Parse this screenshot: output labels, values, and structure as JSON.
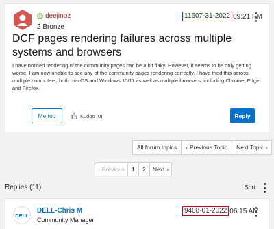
{
  "post": {
    "author": "deejinoz",
    "rank": "2 Bronze",
    "date": "11607-31-2022",
    "time": "09:21 PM",
    "title": "DCF pages rendering failures across multiple systems and browsers",
    "body": "I have noticed rendering of the community pages can be a bit flaky. However, it seems to be only getting worse. I am now unable to see any of the community pages rendering correctly. I have tried this across multiple computers, both macOS and Windows 10/11 as well as multiple browsers, including Chrome, Edge and Firefox.",
    "me_too_label": "Me too",
    "kudos_label": "Kudos (0)",
    "reply_label": "Reply"
  },
  "topic_nav": {
    "all_label": "All forum topics",
    "prev_label": "Previous Topic",
    "next_label": "Next Topic"
  },
  "pager": {
    "prev_label": "Previous",
    "page1": "1",
    "page2": "2",
    "next_label": "Next"
  },
  "replies": {
    "title": "Replies (11)",
    "sort_label": "Sort:"
  },
  "reply": {
    "author": "DELL-Chris M",
    "role": "Community Manager",
    "date": "9408-01-2022",
    "time": "06:15 AM",
    "logo_text": "DELL"
  },
  "colors": {
    "accent": "#0672cb",
    "author_red": "#b42318",
    "highlight_box": "#d0021b",
    "avatar_bg": "#d9534f"
  }
}
